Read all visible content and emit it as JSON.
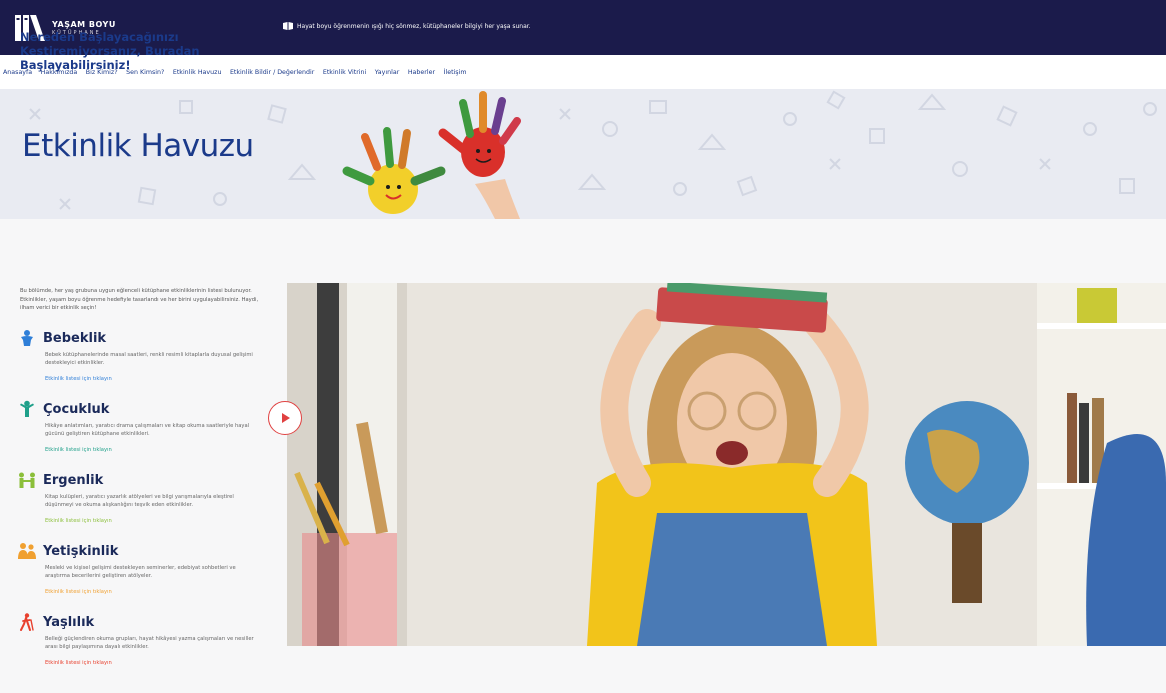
{
  "header": {
    "logo_line1": "YAŞAM BOYU",
    "logo_line2": "KÜTÜPHANE",
    "tagline": "Hayat boyu öğrenmenin ışığı hiç sönmez, kütüphaneler bilgiyi her yaşa sunar."
  },
  "nav": {
    "items": [
      "Anasayfa",
      "Hakkımızda",
      "Biz Kimiz?",
      "Sen Kimsin?",
      "Etkinlik Havuzu",
      "Etkinlik Bildir / Değerlendir",
      "Etkinlik Vitrini",
      "Yayınlar",
      "Haberler",
      "İletişim"
    ]
  },
  "hero": {
    "title": "Etkinlik Havuzu"
  },
  "main": {
    "headline": "Nereden Başlayacağınızı Kestiremiyorsanız, Buradan Başlayabilirsiniz!",
    "intro": "Bu bölümde, her yaş grubuna uygun eğlenceli kütüphane etkinliklerinin listesi bulunuyor. Etkinlikler, yaşam boyu öğrenme hedefiyle tasarlandı ve her birini uygulayabilirsiniz. Haydi, ilham verici bir etkinlik seçin!",
    "stages": [
      {
        "title": "Bebeklik",
        "desc": "Bebek kütüphanelerinde masal saatleri, renkli resimli kitaplarla duyusal gelişimi destekleyici etkinlikler.",
        "link": "Etkinlik listesi için tıklayın",
        "color": "#2f7fd8"
      },
      {
        "title": "Çocukluk",
        "desc": "Hikâye anlatımları, yaratıcı drama çalışmaları ve kitap okuma saatleriyle hayal gücünü geliştiren kütüphane etkinlikleri.",
        "link": "Etkinlik listesi için tıklayın",
        "color": "#1fa08a"
      },
      {
        "title": "Ergenlik",
        "desc": "Kitap kulüpleri, yaratıcı yazarlık atölyeleri ve bilgi yarışmalarıyla eleştirel düşünmeyi ve okuma alışkanlığını teşvik eden etkinlikler.",
        "link": "Etkinlik listesi için tıklayın",
        "color": "#8bbf3a"
      },
      {
        "title": "Yetişkinlik",
        "desc": "Mesleki ve kişisel gelişimi destekleyen seminerler, edebiyat sohbetleri ve araştırma becerilerini geliştiren atölyeler.",
        "link": "Etkinlik listesi için tıklayın",
        "color": "#f0a030"
      },
      {
        "title": "Yaşlılık",
        "desc": "Belleği güçlendiren okuma grupları, hayat hikâyesi yazma çalışmaları ve nesiller arası bilgi paylaşımına dayalı etkinlikler.",
        "link": "Etkinlik listesi için tıklayın",
        "color": "#e8402e"
      }
    ]
  },
  "icons": {
    "tagline": "open-book-icon",
    "play": "play-icon",
    "stages": [
      "baby-icon",
      "child-icon",
      "teen-icon",
      "adults-icon",
      "elderly-walking-icon"
    ]
  },
  "colors": {
    "topbar": "#1b1b4b",
    "primary_blue": "#1b3a8a",
    "play_red": "#e04141"
  }
}
